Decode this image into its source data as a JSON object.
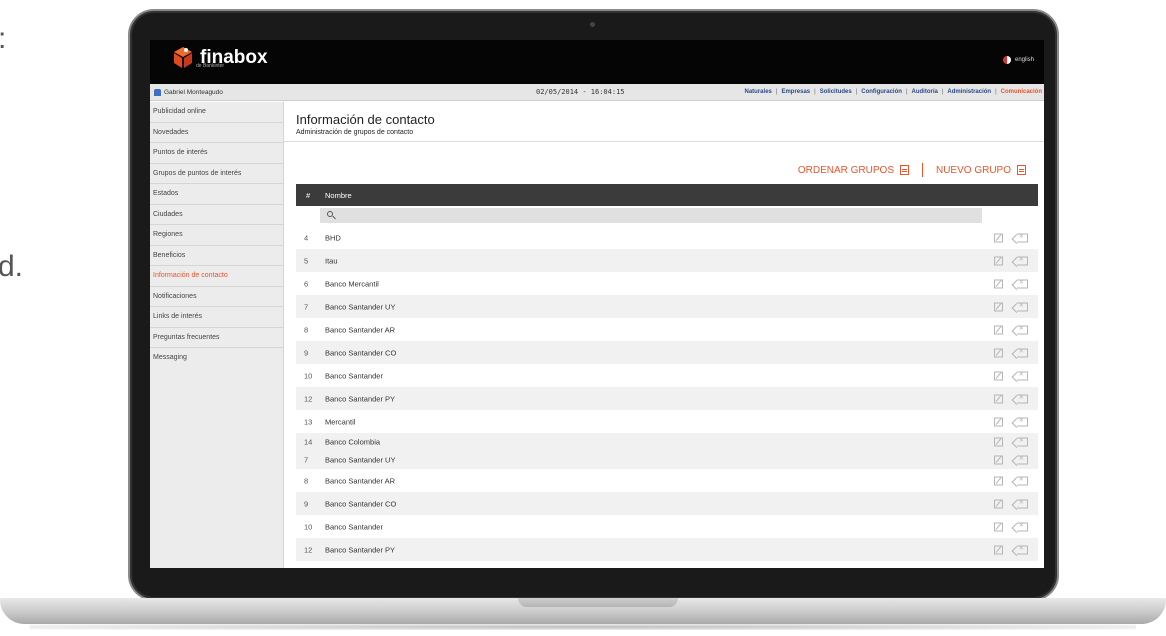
{
  "background_text": [
    ":",
    "d."
  ],
  "app": {
    "logo_text": "finabox",
    "logo_subtext": "de Bankinter",
    "language": "english"
  },
  "subbar": {
    "user": "Gabriel Monteagudo",
    "datetime": "02/05/2014 - 16:04:15",
    "nav": [
      "Naturales",
      "Empresas",
      "Solicitudes",
      "Configuración",
      "Auditoría",
      "Administración",
      "Comunicación"
    ],
    "nav_active": "Comunicación"
  },
  "sidebar": {
    "items": [
      "Publicidad online",
      "Novedades",
      "Puntos de interés",
      "Grupos de puntos de interés",
      "Estados",
      "Ciudades",
      "Regiones",
      "Beneficios",
      "Información de contacto",
      "Notificaciones",
      "Links de interés",
      "Preguntas frecuentes",
      "Messaging"
    ],
    "active": "Información de contacto"
  },
  "main": {
    "title": "Información de contacto",
    "subtitle": "Administración de grupos de contacto",
    "order_label": "ORDENAR GRUPOS",
    "new_label": "NUEVO GRUPO",
    "col_num": "#",
    "col_name": "Nombre",
    "rows": [
      {
        "num": "4",
        "name": "BHD"
      },
      {
        "num": "5",
        "name": "Itau"
      },
      {
        "num": "6",
        "name": "Banco Mercantil"
      },
      {
        "num": "7",
        "name": "Banco Santander UY"
      },
      {
        "num": "8",
        "name": "Banco Santander AR"
      },
      {
        "num": "9",
        "name": "Banco Santander CO"
      },
      {
        "num": "10",
        "name": "Banco Santander"
      },
      {
        "num": "12",
        "name": "Banco Santander PY"
      },
      {
        "num": "13",
        "name": "Mercantil"
      },
      {
        "num": "14",
        "name": "Banco Colombia"
      },
      {
        "num": "7",
        "name": "Banco Santander UY"
      },
      {
        "num": "8",
        "name": "Banco Santander AR"
      },
      {
        "num": "9",
        "name": "Banco Santander CO"
      },
      {
        "num": "10",
        "name": "Banco Santander"
      },
      {
        "num": "12",
        "name": "Banco Santander PY"
      }
    ]
  },
  "colors": {
    "accent": "#e8552b",
    "nav_link": "#2a4a8a",
    "header_bg": "#3b3b3b"
  }
}
